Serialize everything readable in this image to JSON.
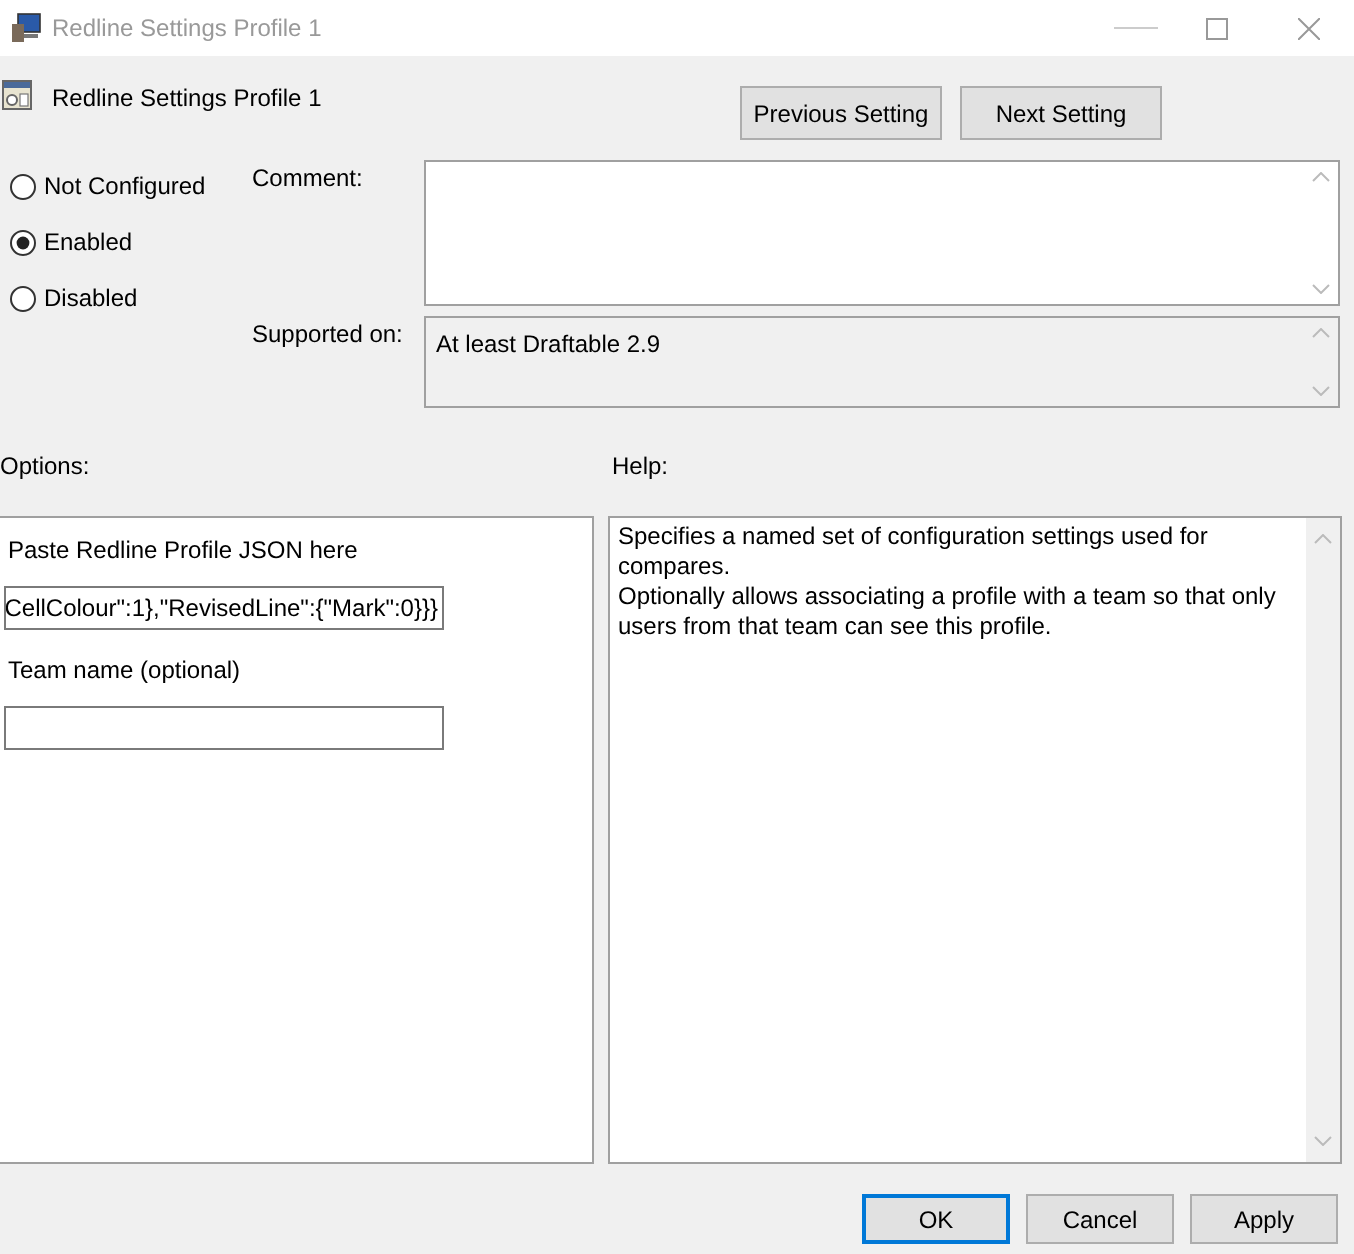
{
  "window": {
    "title": "Redline Settings Profile 1"
  },
  "header": {
    "title": "Redline Settings Profile 1"
  },
  "nav_buttons": [
    {
      "label": "Previous Setting"
    },
    {
      "label": "Next Setting"
    }
  ],
  "state_options": [
    {
      "label": "Not Configured",
      "selected": false
    },
    {
      "label": "Enabled",
      "selected": true
    },
    {
      "label": "Disabled",
      "selected": false
    }
  ],
  "comment": {
    "label": "Comment:"
  },
  "supported_on": {
    "label": "Supported on:",
    "value": "At least Draftable 2.9"
  },
  "options": {
    "label": "Options:",
    "items": [
      {
        "kind": "label",
        "text": "Paste Redline Profile JSON here"
      },
      {
        "kind": "input",
        "value": "CellColour\":1},\"RevisedLine\":{\"Mark\":0}}}"
      },
      {
        "kind": "label",
        "text": "Team name (optional)"
      },
      {
        "kind": "input"
      }
    ]
  },
  "help": {
    "label": "Help:",
    "paragraphs": [
      "Specifies a named set of configuration settings used for compares.",
      "Optionally allows associating a profile with a team so that only users from that team can see this profile."
    ]
  },
  "buttons": [
    {
      "label": "OK",
      "default": true
    },
    {
      "label": "Cancel",
      "default": false
    },
    {
      "label": "Apply",
      "default": false
    }
  ]
}
